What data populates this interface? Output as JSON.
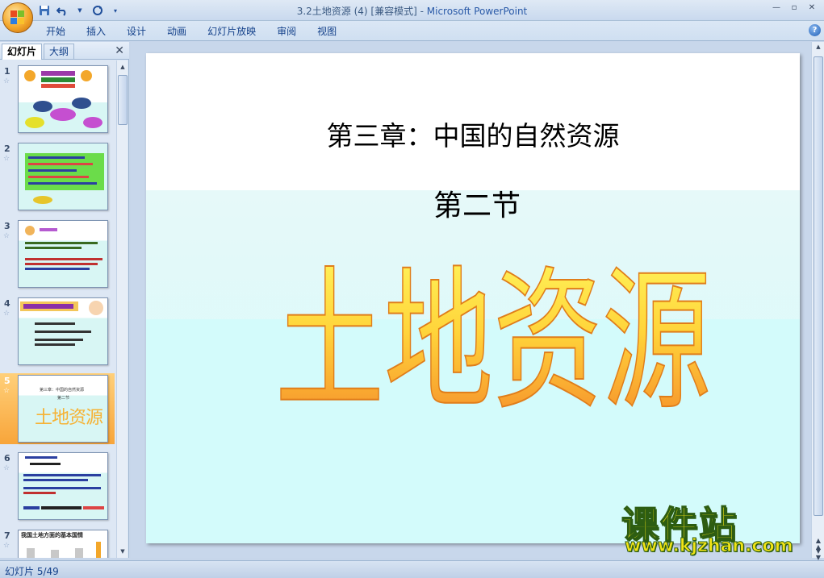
{
  "window": {
    "title": "3.2土地资源 (4) [兼容模式] - ",
    "app_name": "Microsoft PowerPoint",
    "minimize": "—",
    "restore": "▫",
    "close": "✕"
  },
  "qat": {
    "save_icon": "save-icon",
    "undo_icon": "undo-icon",
    "redo_icon": "redo-icon"
  },
  "ribbon": {
    "tabs": [
      "开始",
      "插入",
      "设计",
      "动画",
      "幻灯片放映",
      "审阅",
      "视图"
    ],
    "help": "?"
  },
  "left_pane": {
    "tabs": [
      "幻灯片",
      "大纲"
    ],
    "close": "✕",
    "slides": [
      {
        "num": "1"
      },
      {
        "num": "2"
      },
      {
        "num": "3"
      },
      {
        "num": "4"
      },
      {
        "num": "5"
      },
      {
        "num": "6"
      },
      {
        "num": "7",
        "text": "我国土地方面的基本国情"
      }
    ],
    "selected_slide": 5
  },
  "slide": {
    "heading": "第三章：中国的自然资源",
    "subheading": "第二节",
    "big_title": "土地资源",
    "thumb_heading": "第三章：中国的自然资源",
    "thumb_sub": "第二节",
    "thumb_big": "土地资源"
  },
  "status": {
    "text": "幻灯片 5/49"
  },
  "watermark": {
    "cn": "课件站",
    "url": "www.kjzhan.com"
  }
}
